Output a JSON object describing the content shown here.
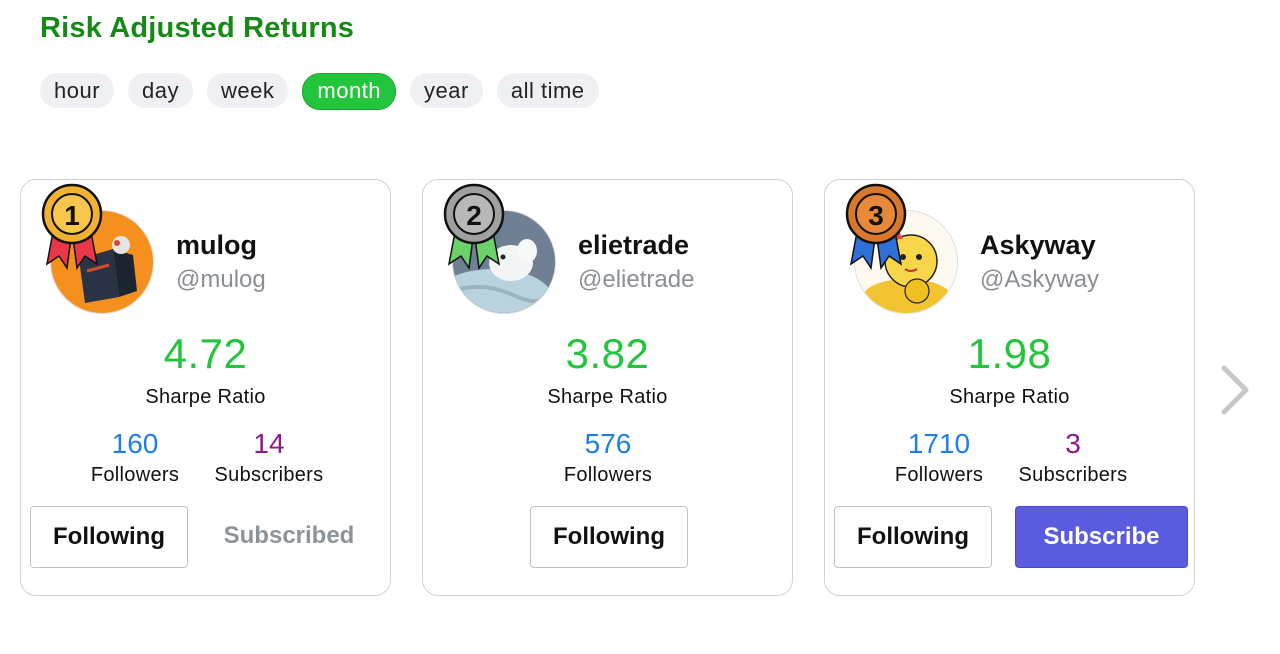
{
  "header": {
    "title": "Risk Adjusted Returns"
  },
  "periods": [
    "hour",
    "day",
    "week",
    "month",
    "year",
    "all time"
  ],
  "active_period": "month",
  "cards": [
    {
      "rank": "1",
      "name": "mulog",
      "handle": "@mulog",
      "sharpe": "4.72",
      "sharpe_label": "Sharpe Ratio",
      "followers": "160",
      "followers_label": "Followers",
      "subscribers": "14",
      "subscribers_label": "Subscribers",
      "follow_button": "Following",
      "subscribe_button": "Subscribed"
    },
    {
      "rank": "2",
      "name": "elietrade",
      "handle": "@elietrade",
      "sharpe": "3.82",
      "sharpe_label": "Sharpe Ratio",
      "followers": "576",
      "followers_label": "Followers",
      "follow_button": "Following"
    },
    {
      "rank": "3",
      "name": "Askyway",
      "handle": "@Askyway",
      "sharpe": "1.98",
      "sharpe_label": "Sharpe Ratio",
      "followers": "1710",
      "followers_label": "Followers",
      "subscribers": "3",
      "subscribers_label": "Subscribers",
      "follow_button": "Following",
      "subscribe_button": "Subscribe"
    }
  ],
  "icons": {
    "medal_1": "gold-medal-icon",
    "medal_2": "silver-medal-icon",
    "medal_3": "bronze-medal-icon",
    "next": "chevron-right-icon"
  },
  "colors": {
    "title": "#168a16",
    "accent_green": "#22c53c",
    "followers_blue": "#1f7ee8",
    "subscribers_purple": "#8a1a8a",
    "subscribe_button": "#5b5bdf",
    "gold": "#f0b232",
    "silver": "#a0a0a0",
    "bronze": "#d9782a"
  }
}
